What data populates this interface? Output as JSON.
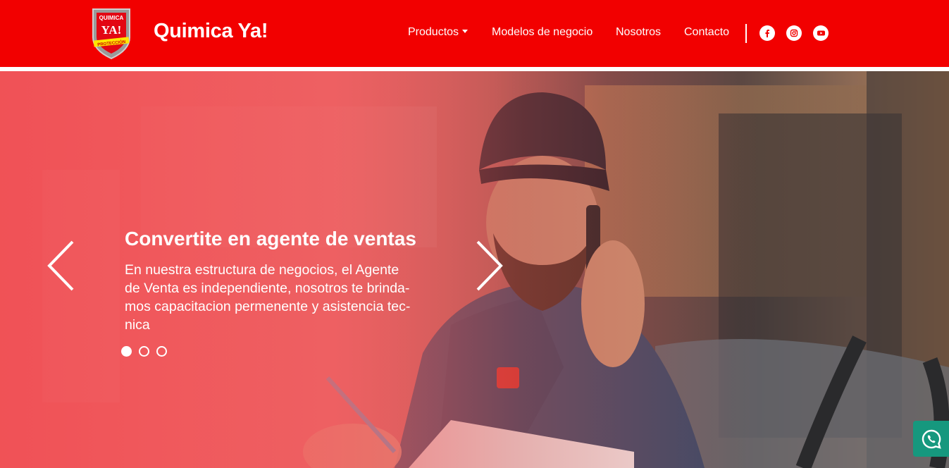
{
  "header": {
    "logo_text": [
      "QUIMICA",
      "YA!",
      "PROTECCIÓN"
    ],
    "brand": "Quimica Ya!",
    "nav": [
      {
        "label": "Productos",
        "dropdown": true
      },
      {
        "label": "Modelos de negocio"
      },
      {
        "label": "Nosotros"
      },
      {
        "label": "Contacto"
      }
    ],
    "social_icons": [
      "facebook-icon",
      "instagram-icon",
      "youtube-icon"
    ]
  },
  "hero": {
    "title": "Convertite en agente de ventas",
    "lines": [
      "En nuestra estructura de negocios, el Agente",
      "de Venta es independiente, nosotros te brinda-",
      "mos capacitacion permenente y asistencia tec-",
      "nica"
    ],
    "slides_count": 3,
    "active_slide": 1
  },
  "colors": {
    "brand_red": "#f20000",
    "whatsapp_green": "#16987e"
  },
  "floating": {
    "icon": "whatsapp-icon"
  }
}
